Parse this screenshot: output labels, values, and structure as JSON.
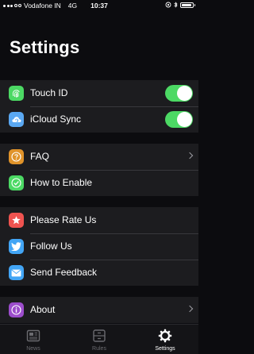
{
  "status": {
    "carrier": "Vodafone IN",
    "network": "4G",
    "time": "10:37"
  },
  "page_title": "Settings",
  "groups": [
    {
      "items": [
        {
          "label": "Touch ID",
          "icon": "fingerprint-icon",
          "color": "#4cd964",
          "toggle": true
        },
        {
          "label": "iCloud Sync",
          "icon": "cloud-sync-icon",
          "color": "#5aa8f2",
          "toggle": true
        }
      ]
    },
    {
      "items": [
        {
          "label": "FAQ",
          "icon": "question-icon",
          "color": "#e0932a",
          "chevron": true
        },
        {
          "label": "How to Enable",
          "icon": "checkmark-icon",
          "color": "#4cd964"
        }
      ]
    },
    {
      "items": [
        {
          "label": "Please Rate Us",
          "icon": "star-icon",
          "color": "#ef5350"
        },
        {
          "label": "Follow Us",
          "icon": "twitter-icon",
          "color": "#42a5f5"
        },
        {
          "label": "Send Feedback",
          "icon": "mail-icon",
          "color": "#42a5f5"
        }
      ]
    },
    {
      "items": [
        {
          "label": "About",
          "icon": "info-icon",
          "color": "#9c4dcc",
          "chevron": true
        }
      ]
    }
  ],
  "tabs": [
    {
      "label": "News",
      "icon": "news-icon",
      "active": false
    },
    {
      "label": "Rules",
      "icon": "rules-icon",
      "active": false
    },
    {
      "label": "Settings",
      "icon": "gear-icon",
      "active": true
    }
  ],
  "colors": {
    "background": "#0c0c0f",
    "cell": "#1c1c1f",
    "toggle_on": "#4cd964"
  }
}
